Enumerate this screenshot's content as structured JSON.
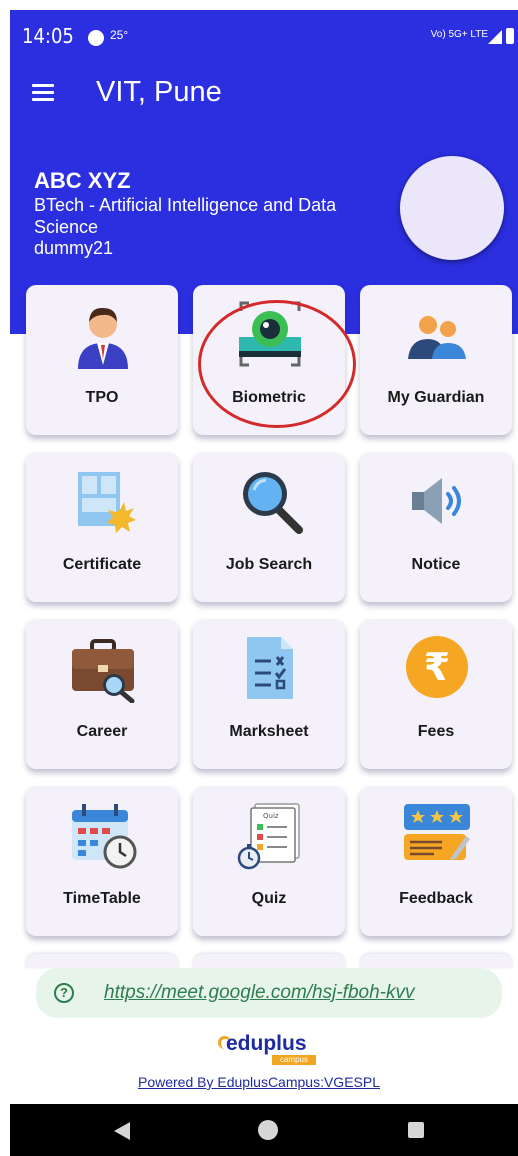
{
  "status_bar": {
    "time": "14:05",
    "temperature": "25°",
    "network": "Vo) 5G+ LTE"
  },
  "app_bar": {
    "title": "VIT, Pune",
    "menu_icon": "hamburger-icon"
  },
  "profile": {
    "name": "ABC XYZ",
    "program": "BTech - Artificial Intelligence and Data Science",
    "user_id": "dummy21"
  },
  "tiles": [
    {
      "label": "TPO",
      "icon": "person-tie-icon"
    },
    {
      "label": "Biometric",
      "icon": "eye-scan-icon"
    },
    {
      "label": "My Guardian",
      "icon": "people-icon"
    },
    {
      "label": "Certificate",
      "icon": "certificate-icon"
    },
    {
      "label": "Job Search",
      "icon": "magnifier-icon"
    },
    {
      "label": "Notice",
      "icon": "speaker-icon"
    },
    {
      "label": "Career",
      "icon": "briefcase-icon"
    },
    {
      "label": "Marksheet",
      "icon": "marksheet-icon"
    },
    {
      "label": "Fees",
      "icon": "rupee-icon"
    },
    {
      "label": "TimeTable",
      "icon": "calendar-clock-icon"
    },
    {
      "label": "Quiz",
      "icon": "quiz-icon"
    },
    {
      "label": "Feedback",
      "icon": "feedback-icon"
    }
  ],
  "link_bar": {
    "url": "https://meet.google.com/hsj-fboh-kvv",
    "icon": "help-circle-icon"
  },
  "footer": {
    "logo_main": "eduplus",
    "logo_sub": "campus",
    "powered_by": "Powered By EduplusCampus:VGESPL"
  },
  "colors": {
    "primary": "#2b2fe0",
    "tile_bg": "#f5f1fb",
    "highlight_circle": "#d42a2a",
    "link_green": "#2e7d4f"
  }
}
